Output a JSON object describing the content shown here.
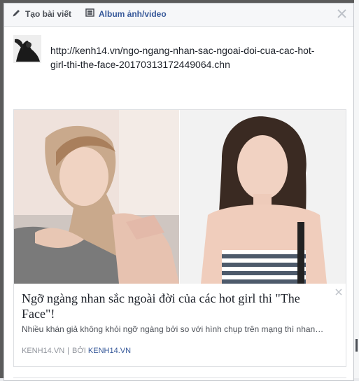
{
  "tabs": {
    "create_post": "Tạo bài viết",
    "album": "Album ảnh/video"
  },
  "composer": {
    "url": "http://kenh14.vn/ngo-ngang-nhan-sac-ngoai-doi-cua-cac-hot-girl-thi-the-face-20170313172449064.chn"
  },
  "link_card": {
    "title": "Ngỡ ngàng nhan sắc ngoài đời của các hot girl thi \"The Face\"!",
    "description": "Nhiều khán giả không khỏi ngỡ ngàng bởi so với hình chụp trên mạng thì nhan…",
    "domain": "KENH14.VN",
    "separator": "|",
    "by_label": "BỞI",
    "by_source": "KENH14.VN"
  },
  "colors": {
    "accent": "#365899",
    "tab_bar": "#f6f7f9",
    "border": "#dddfe2"
  },
  "icons": [
    "pencil-icon",
    "photo-album-icon",
    "close-icon",
    "card-remove-icon"
  ]
}
